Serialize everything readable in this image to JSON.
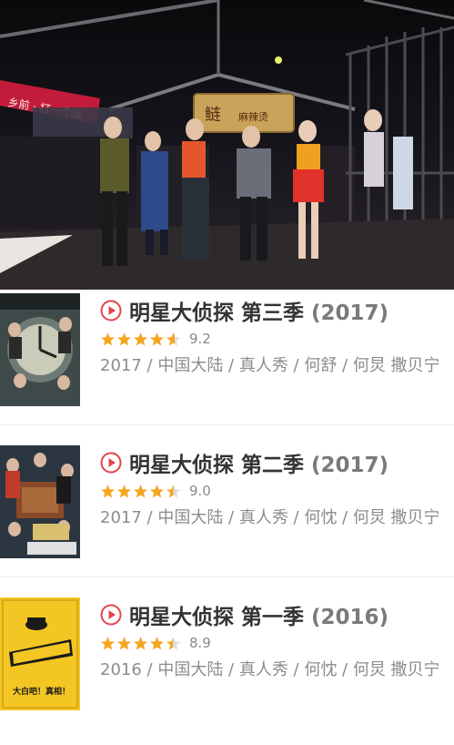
{
  "hero": {
    "image": "variety-show-stage-photo",
    "sign_text": "鲢",
    "sign_sub": "麻辣烫",
    "banner_text": "乡前 · 打一个饭"
  },
  "items": [
    {
      "title": "明星大侦探 第三季",
      "year": "(2017)",
      "rating": 9.2,
      "rating_text": "9.2",
      "stars_full": 4,
      "meta": "2017 / 中国大陆 / 真人秀 / 何舒 / 何炅 撒贝宁",
      "poster": "season-3-poster",
      "poster_colors": [
        "#2a3a3a",
        "#5a6a6a",
        "#c8c8b8"
      ]
    },
    {
      "title": "明星大侦探 第二季",
      "year": "(2017)",
      "rating": 9.0,
      "rating_text": "9.0",
      "stars_full": 4,
      "meta": "2017 / 中国大陆 / 真人秀 / 何忱 / 何炅 撒贝宁",
      "poster": "season-2-poster",
      "poster_colors": [
        "#2b3640",
        "#8a4a2a",
        "#d8c070"
      ]
    },
    {
      "title": "明星大侦探 第一季",
      "year": "(2016)",
      "rating": 8.9,
      "rating_text": "8.9",
      "stars_full": 4,
      "meta": "2016 / 中国大陆 / 真人秀 / 何忱 / 何炅 撒贝宁",
      "poster": "season-1-poster",
      "poster_text": "大白吧！真相！",
      "poster_colors": [
        "#f3c623",
        "#1a1a1a",
        "#ffffff"
      ]
    }
  ],
  "colors": {
    "accent": "#e0464e",
    "star": "#f5a623",
    "star_empty": "#dddddd"
  }
}
